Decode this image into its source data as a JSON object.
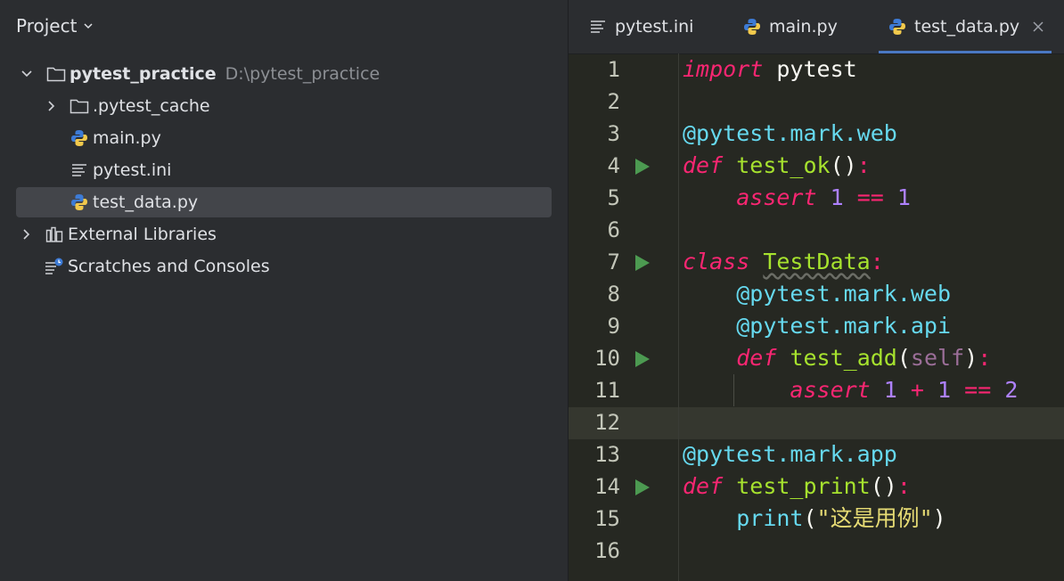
{
  "project": {
    "header": "Project",
    "tree": [
      {
        "label": "pytest_practice",
        "hint": "D:\\pytest_practice"
      },
      {
        "label": ".pytest_cache"
      },
      {
        "label": "main.py"
      },
      {
        "label": "pytest.ini"
      },
      {
        "label": "test_data.py"
      },
      {
        "label": "External Libraries"
      },
      {
        "label": "Scratches and Consoles"
      }
    ]
  },
  "tabs": [
    {
      "label": "pytest.ini",
      "icon": "text-file-icon"
    },
    {
      "label": "main.py",
      "icon": "python-icon"
    },
    {
      "label": "test_data.py",
      "icon": "python-icon",
      "active": true
    }
  ],
  "editor": {
    "current_line": "12",
    "lines": [
      {
        "n": "1",
        "t": [
          "import",
          " pytest"
        ]
      },
      {
        "n": "2",
        "t": []
      },
      {
        "n": "3",
        "t": [
          "@pytest.mark.web"
        ]
      },
      {
        "n": "4",
        "t": [
          "def",
          " ",
          "test_ok",
          "():"
        ]
      },
      {
        "n": "5",
        "t": [
          "    ",
          "assert",
          " ",
          "1",
          " ",
          "==",
          " ",
          "1"
        ]
      },
      {
        "n": "6",
        "t": []
      },
      {
        "n": "7",
        "t": [
          "class",
          " ",
          "TestData",
          ":"
        ]
      },
      {
        "n": "8",
        "t": [
          "    ",
          "@pytest.mark.web"
        ]
      },
      {
        "n": "9",
        "t": [
          "    ",
          "@pytest.mark.api"
        ]
      },
      {
        "n": "10",
        "t": [
          "    ",
          "def",
          " ",
          "test_add",
          "(",
          "self",
          ")",
          ":"
        ]
      },
      {
        "n": "11",
        "t": [
          "        ",
          "assert",
          " ",
          "1",
          " ",
          "+",
          " ",
          "1",
          " ",
          "==",
          " ",
          "2"
        ]
      },
      {
        "n": "12",
        "t": []
      },
      {
        "n": "13",
        "t": [
          "@pytest.mark.app"
        ]
      },
      {
        "n": "14",
        "t": [
          "def",
          " ",
          "test_print",
          "()",
          ":"
        ]
      },
      {
        "n": "15",
        "t": [
          "    ",
          "print",
          "(",
          "\"这是用例\"",
          ")"
        ]
      },
      {
        "n": "16",
        "t": []
      }
    ]
  },
  "colors": {
    "keyword": "#f92672",
    "decorator": "#66d9ef",
    "function": "#a6e22e",
    "number": "#ae81ff",
    "string": "#e6db74",
    "run_icon": "#4c9a51"
  }
}
